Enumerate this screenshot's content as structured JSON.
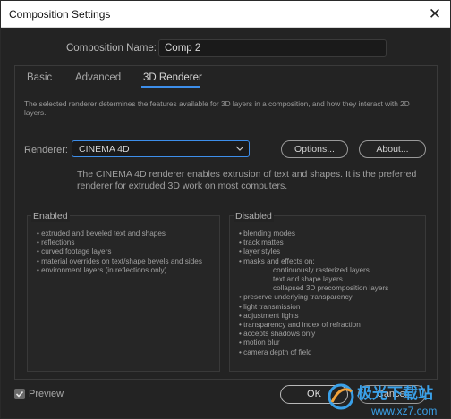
{
  "window": {
    "title": "Composition Settings",
    "close_glyph": "✕"
  },
  "composition": {
    "name_label": "Composition Name:",
    "name_value": "Comp 2"
  },
  "tabs": [
    {
      "label": "Basic"
    },
    {
      "label": "Advanced"
    },
    {
      "label": "3D Renderer"
    }
  ],
  "description": "The selected renderer determines the features available for 3D layers in a composition, and how they interact with 2D layers.",
  "renderer": {
    "label": "Renderer:",
    "selected": "CINEMA 4D",
    "options_label": "Options...",
    "about_label": "About...",
    "info": "The CINEMA 4D renderer enables extrusion of text and shapes. It is the preferred renderer for extruded 3D work on most computers."
  },
  "enabled": {
    "title": "Enabled",
    "items": [
      "• extruded and beveled text and shapes",
      "• reflections",
      "• curved footage layers",
      "• material overrides on text/shape bevels and sides",
      "• environment layers (in reflections only)"
    ]
  },
  "disabled": {
    "title": "Disabled",
    "items": [
      "• blending modes",
      "• track mattes",
      "• layer styles",
      "• masks and effects on:",
      "continuously rasterized layers",
      "text and shape layers",
      "collapsed 3D precomposition layers",
      "• preserve underlying transparency",
      "• light transmission",
      "• adjustment lights",
      "• transparency and index of refraction",
      "• accepts shadows only",
      "• motion blur",
      "• camera depth of field"
    ]
  },
  "footer": {
    "preview_label": "Preview",
    "preview_checked": true,
    "ok_label": "OK",
    "cancel_label": "Cancel"
  },
  "watermark": {
    "text": "极光下载站",
    "url": "www.xz7.com"
  },
  "colors": {
    "accent": "#3d8eea",
    "background": "#232323",
    "titlebar": "#ffffff"
  }
}
